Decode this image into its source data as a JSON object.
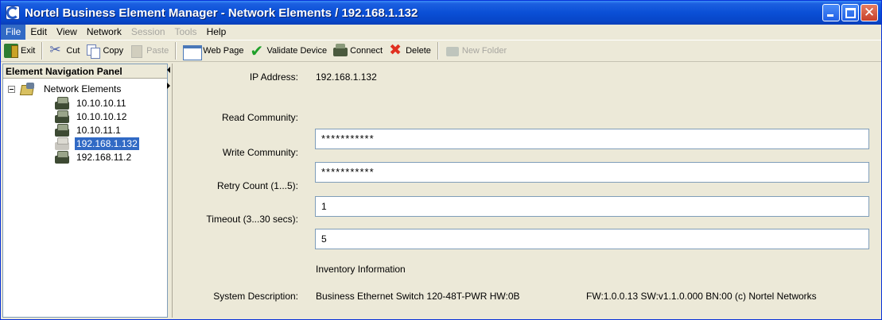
{
  "window": {
    "title": "Nortel Business Element Manager - Network Elements / 192.168.1.132"
  },
  "menu": [
    {
      "label": "File",
      "state": "active"
    },
    {
      "label": "Edit",
      "state": "normal"
    },
    {
      "label": "View",
      "state": "normal"
    },
    {
      "label": "Network",
      "state": "normal"
    },
    {
      "label": "Session",
      "state": "disabled"
    },
    {
      "label": "Tools",
      "state": "disabled"
    },
    {
      "label": "Help",
      "state": "normal"
    }
  ],
  "toolbar": {
    "exit": "Exit",
    "cut": "Cut",
    "copy": "Copy",
    "paste": "Paste",
    "web_page": "Web Page",
    "validate": "Validate Device",
    "connect": "Connect",
    "delete": "Delete",
    "new_folder": "New Folder"
  },
  "nav": {
    "header": "Element Navigation Panel",
    "root": "Network Elements",
    "items": [
      {
        "label": "10.10.10.11",
        "selected": false
      },
      {
        "label": "10.10.10.12",
        "selected": false
      },
      {
        "label": "10.10.11.1",
        "selected": false
      },
      {
        "label": "192.168.1.132",
        "selected": true
      },
      {
        "label": "192.168.11.2",
        "selected": false
      }
    ]
  },
  "form": {
    "ip_label": "IP Address:",
    "ip_value": "192.168.1.132",
    "read_label": "Read Community:",
    "read_value": "***********",
    "write_label": "Write Community:",
    "write_value": "***********",
    "retry_label": "Retry Count (1...5):",
    "retry_value": "1",
    "timeout_label": "Timeout (3...30 secs):",
    "timeout_value": "5",
    "inventory_heading": "Inventory Information",
    "sysdesc_label": "System Description:",
    "sysdesc_value": "Business Ethernet Switch 120-48T-PWR  HW:0B",
    "sysdesc_value2": "FW:1.0.0.13  SW:v1.1.0.000 BN:00 (c) Nortel Networks"
  },
  "colors": {
    "selection": "#316ac5",
    "titlebar": "#0a4fd6"
  }
}
